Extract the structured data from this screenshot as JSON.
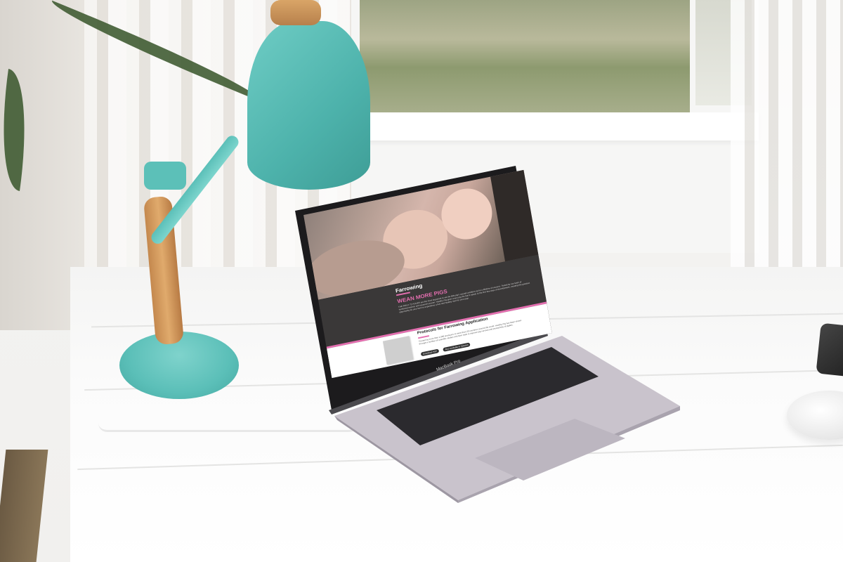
{
  "scene": {
    "description_objects": [
      "desk-lamp",
      "laptop",
      "mouse",
      "phone",
      "window",
      "curtains",
      "plant"
    ]
  },
  "laptop": {
    "brand_label": "MacBook Pro"
  },
  "website": {
    "section_title": "Farrowing",
    "headline": "WEAN MORE PIGS",
    "intro_text": "THE FIRST 72 HOURS are the most important to set the little pig's overall condition up for a lifetime of success. Tested by our team of nutritional experts and research-proven, Healthy Pig gives every pig the fuel it needs at the first few days of development, creating the greatest opportunity for your farm to experience a fast and healthy start for your pigs.",
    "protocols_title": "Protocols for Farrowing Application",
    "protocols_text": "Trusted by more than 1,000 producers in more than 20 countries around the world, Healthy Pig has been shown through a number of scientific studies and farm trials to improve pig survival and productivity of piglets.",
    "button_download": "Download PDF",
    "button_spanish": "Also available in Spanish",
    "accent_color": "#e46fb0",
    "dark_bg": "#3a3838"
  }
}
